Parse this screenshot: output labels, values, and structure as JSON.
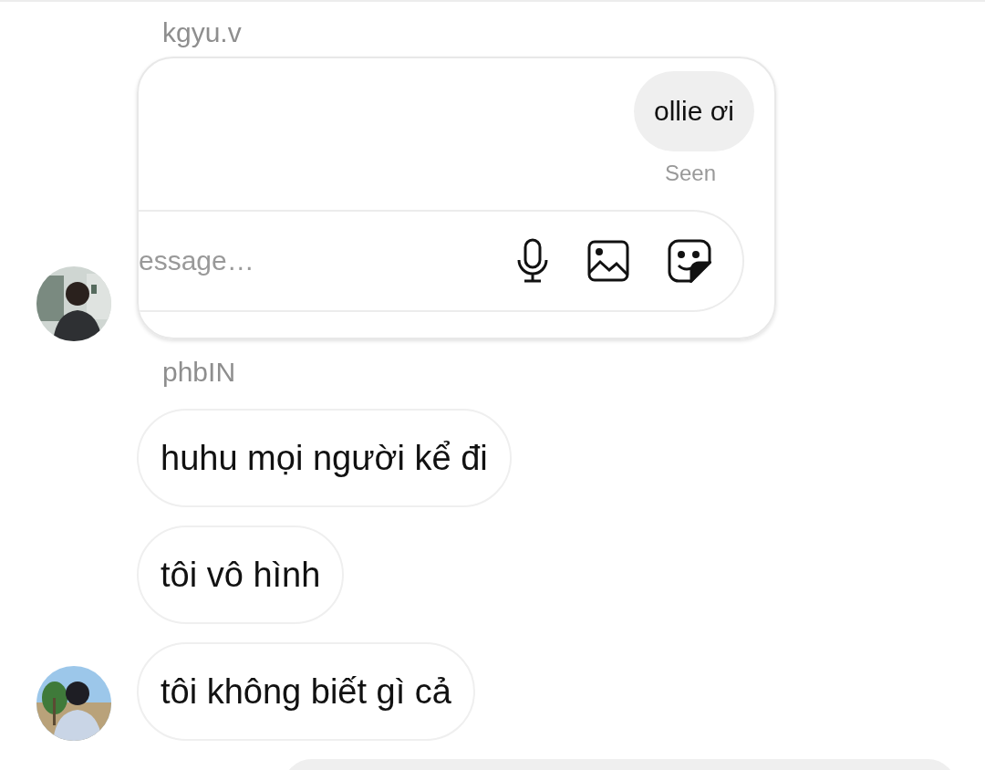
{
  "groups": [
    {
      "sender": "kgyu.v",
      "avatar": {
        "kind": "picture"
      },
      "messages": [
        {
          "kind": "screenshot",
          "bubble": "ollie ơi",
          "status": "Seen",
          "composer": {
            "placeholder": "essage…"
          }
        }
      ]
    },
    {
      "sender": "phbIN",
      "avatar": {
        "kind": "picture"
      },
      "messages": [
        {
          "kind": "text",
          "text": "huhu mọi người kể đi"
        },
        {
          "kind": "text",
          "text": "tôi vô hình"
        },
        {
          "kind": "text",
          "text": "tôi không biết gì cả"
        }
      ]
    }
  ],
  "next_bubble": {
    "outgoing": true
  }
}
